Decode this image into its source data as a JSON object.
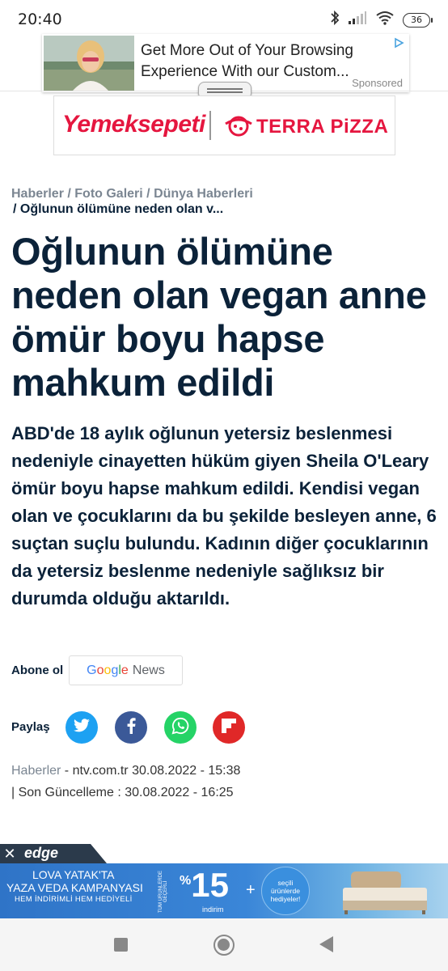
{
  "status_bar": {
    "time": "20:40",
    "battery": "36",
    "icons": [
      "bluetooth-icon",
      "signal-icon",
      "wifi-icon",
      "battery-icon"
    ]
  },
  "top_ad": {
    "line1": "Get More Out of Your Browsing",
    "line2": "Experience With our Custom...",
    "sponsored": "Sponsored"
  },
  "banner": {
    "left_brand": "Yemeksepeti",
    "right_brand": "TERRA PiZZA",
    "brand_color": "#e5163f"
  },
  "breadcrumb": {
    "items": [
      "Haberler",
      "/ Foto Galeri",
      "/ Dünya Haberleri"
    ],
    "current": "/ Oğlunun ölümüne neden olan v..."
  },
  "article": {
    "headline": "Oğlunun ölümüne neden olan vegan anne ömür boyu hapse mahkum edildi",
    "summary": "ABD'de 18 aylık oğlunun yetersiz beslenmesi nedeniyle cinayetten hüküm giyen Sheila O'Leary ömür boyu hapse mahkum edildi. Kendisi vegan olan ve çocuklarını da bu şekilde besleyen anne, 6 suçtan suçlu bulundu. Kadının diğer çocuklarının da yetersiz beslenme nedeniyle sağlıksız bir durumda olduğu aktarıldı."
  },
  "subscribe": {
    "label": "Abone ol",
    "google": [
      "G",
      "o",
      "o",
      "g",
      "l",
      "e"
    ],
    "news": "News"
  },
  "share": {
    "label": "Paylaş",
    "buttons": [
      "twitter-icon",
      "facebook-icon",
      "whatsapp-icon",
      "flipboard-icon"
    ]
  },
  "meta": {
    "source": "Haberler",
    "published": " - ntv.com.tr 30.08.2022 - 15:38",
    "updated": "| Son Güncelleme : 30.08.2022 - 16:25"
  },
  "bottom_ad": {
    "brand": "edge",
    "line1": "LOVA YATAK'TA",
    "line2": "YAZA VEDA KAMPANYASI",
    "line3": "HEM İNDİRİMLİ HEM HEDİYELİ",
    "vertical": "TÜM ÜRÜNLERDE GEÇERLİ",
    "percent_sign": "%",
    "percent": "15",
    "discount_word": "indirim",
    "plus": "+",
    "gift_l1": "seçili",
    "gift_l2": "ürünlerde",
    "gift_l3": "hediyeler!"
  }
}
